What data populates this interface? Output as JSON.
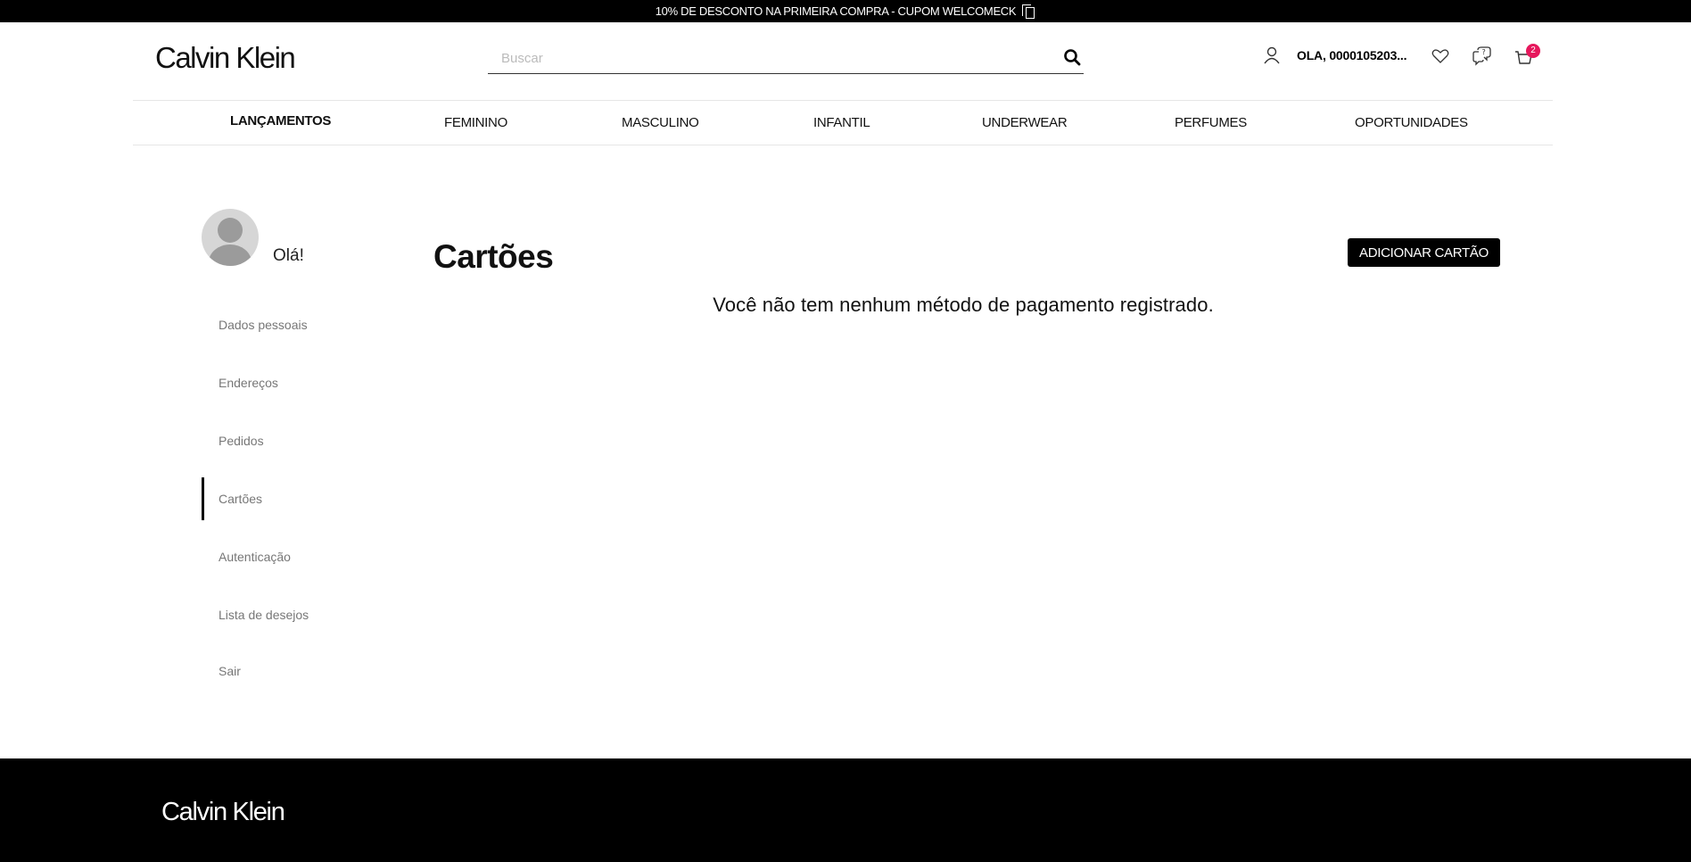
{
  "promo_bar": {
    "text": "10% DE DESCONTO NA PRIMEIRA COMPRA - CUPOM WELCOMECK"
  },
  "header": {
    "logo": "Calvin Klein",
    "search_placeholder": "Buscar",
    "search_value": "",
    "user_greeting": "OLA, 0000105203...",
    "cart_count": "2"
  },
  "nav": {
    "items": [
      "LANÇAMENTOS",
      "FEMININO",
      "MASCULINO",
      "INFANTIL",
      "UNDERWEAR",
      "PERFUMES",
      "OPORTUNIDADES"
    ]
  },
  "sidebar": {
    "greeting": "Olá!",
    "items": [
      "Dados pessoais",
      "Endereços",
      "Pedidos",
      "Cartões",
      "Autenticação",
      "Lista de desejos",
      "Sair"
    ],
    "active_item": "Cartões"
  },
  "main": {
    "title": "Cartões",
    "add_button": "ADICIONAR CARTÃO",
    "empty_message": "Você não tem nenhum método de pagamento registrado."
  },
  "footer": {
    "logo": "Calvin Klein"
  },
  "colors": {
    "accent": "#000000",
    "badge": "#e6175c",
    "muted_text": "#777777"
  }
}
